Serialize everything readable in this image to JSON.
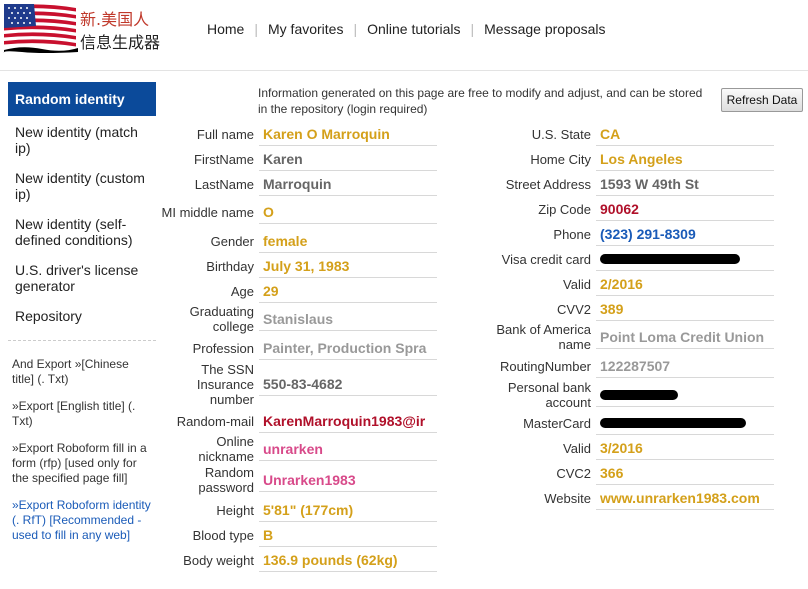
{
  "brand": {
    "line1": "新.美国人",
    "line2": "信息生成器"
  },
  "nav": [
    "Home",
    "My favorites",
    "Online tutorials",
    "Message proposals"
  ],
  "sidebar": {
    "active": "Random identity",
    "items": [
      "New identity (match ip)",
      "New identity (custom ip)",
      "New identity (self-defined conditions)",
      "U.S. driver's license generator",
      "Repository"
    ],
    "exports": [
      "And Export »[Chinese title] (. Txt)",
      "»Export [English title] (. Txt)",
      "»Export Roboform fill in a form (rfp) [used only for the specified page fill]",
      "»Export Roboform identity (. RfT) [Recommended - used to fill in any web]"
    ]
  },
  "notice": "Information generated on this page are free to modify and adjust, and can be stored in the repository (login required)",
  "refresh_label": "Refresh Data",
  "left_fields": [
    {
      "label": "Full name",
      "value": "Karen O Marroquin"
    },
    {
      "label": "FirstName",
      "value": "Karen"
    },
    {
      "label": "LastName",
      "value": "Marroquin"
    },
    {
      "label": "MI middle name",
      "value": "O"
    },
    {
      "label": "Gender",
      "value": "female"
    },
    {
      "label": "Birthday",
      "value": "July  31,  1983"
    },
    {
      "label": "Age",
      "value": "29"
    },
    {
      "label": "Graduating college",
      "value": "Stanislaus"
    },
    {
      "label": "Profession",
      "value": "Painter, Production Spra"
    },
    {
      "label": "The SSN Insurance number",
      "value": "550-83-4682"
    },
    {
      "label": "Random-mail",
      "value": "KarenMarroquin1983@ir"
    },
    {
      "label": "Online nickname",
      "value": "unrarken"
    },
    {
      "label": "Random password",
      "value": "Unrarken1983"
    },
    {
      "label": "Height",
      "value": "5'81\" (177cm)"
    },
    {
      "label": "Blood type",
      "value": "B"
    },
    {
      "label": "Body weight",
      "value": "136.9 pounds (62kg)"
    }
  ],
  "right_fields": [
    {
      "label": "U.S. State",
      "value": "CA"
    },
    {
      "label": "Home City",
      "value": "Los Angeles"
    },
    {
      "label": "Street Address",
      "value": "1593 W 49th St"
    },
    {
      "label": "Zip Code",
      "value": "90062"
    },
    {
      "label": "Phone",
      "value": "(323) 291-8309"
    },
    {
      "label": "Visa credit card",
      "value": ""
    },
    {
      "label": "Valid",
      "value": "2/2016"
    },
    {
      "label": "CVV2",
      "value": "389"
    },
    {
      "label": "Bank of America name",
      "value": "Point Loma Credit Union"
    },
    {
      "label": "RoutingNumber",
      "value": "122287507"
    },
    {
      "label": "Personal bank account",
      "value": ""
    },
    {
      "label": "MasterCard",
      "value": ""
    },
    {
      "label": "Valid",
      "value": "3/2016"
    },
    {
      "label": "CVC2",
      "value": "366"
    },
    {
      "label": "Website",
      "value": "www.unrarken1983.com"
    }
  ],
  "colors": {
    "gold": "#d4a01a",
    "red": "#b0102a",
    "pink": "#d84a8a",
    "blue": "#1a5bb8",
    "nav_active_bg": "#0b4a9a"
  }
}
